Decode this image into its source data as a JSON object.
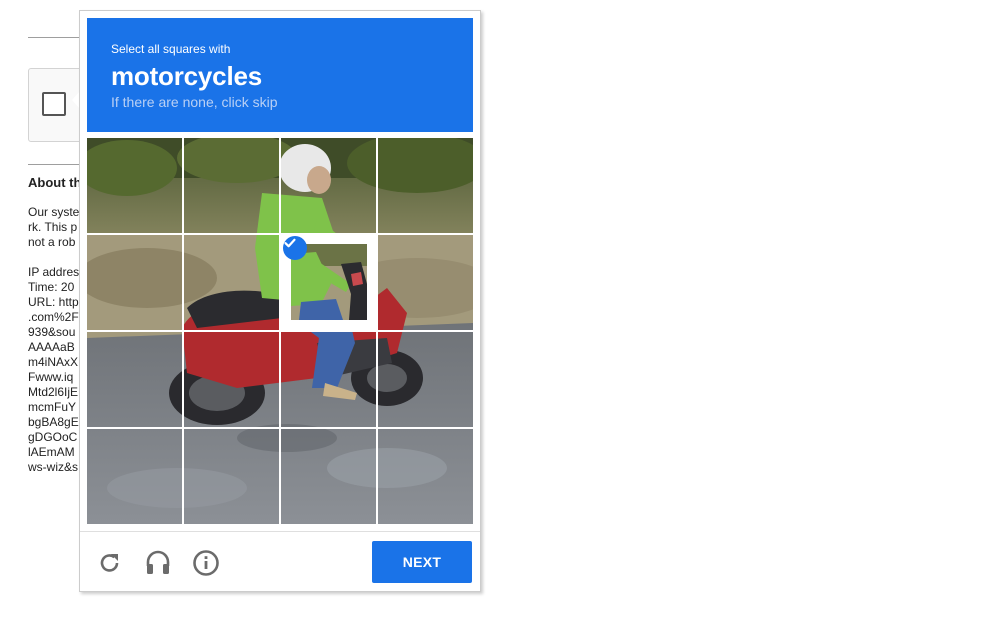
{
  "background_page": {
    "about_title": "About th",
    "lines_group1": [
      "Our syste",
      "rk. This p",
      "not a rob"
    ],
    "lines_group2": [
      "IP addres",
      "Time: 20",
      "URL: http",
      ".com%2F",
      "939&sou",
      "AAAAaB",
      "m4iNAxX",
      "Fwww.iq",
      "Mtd2l6IjE",
      "mcmFuY",
      "bgBA8gE",
      "gDGOoC",
      "lAEmAM",
      "ws-wiz&s"
    ]
  },
  "challenge": {
    "instruction_small": "Select all squares with",
    "target_object": "motorcycles",
    "hint": "If there are none, click skip",
    "grid": {
      "rows": 4,
      "cols": 4,
      "selected_tiles": [
        [
          1,
          2
        ]
      ]
    },
    "footer": {
      "reload_icon": "reload-icon",
      "audio_icon": "headphones-icon",
      "info_icon": "info-icon",
      "next_label": "NEXT"
    }
  },
  "colors": {
    "accent": "#1a73e8",
    "hint_text": "#b9d0f5"
  }
}
